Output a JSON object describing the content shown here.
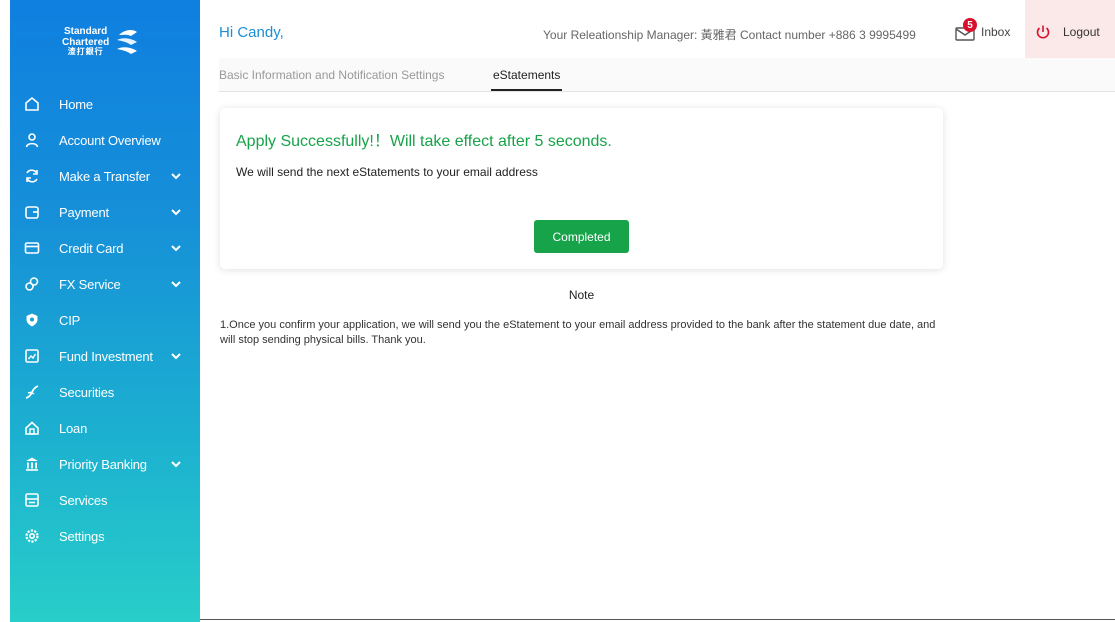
{
  "brand": {
    "line1": "Standard",
    "line2": "Chartered",
    "line3": "渣打銀行",
    "logo_colors": [
      "#0f4fa8",
      "#2fa84f"
    ]
  },
  "sidebar": {
    "items": [
      {
        "label": "Home",
        "icon": "home-icon",
        "expandable": false
      },
      {
        "label": "Account Overview",
        "icon": "user-icon",
        "expandable": false
      },
      {
        "label": "Make a Transfer",
        "icon": "transfer-icon",
        "expandable": true
      },
      {
        "label": "Payment",
        "icon": "wallet-icon",
        "expandable": true
      },
      {
        "label": "Credit Card",
        "icon": "credit-card-icon",
        "expandable": true
      },
      {
        "label": "FX Service",
        "icon": "fx-icon",
        "expandable": true
      },
      {
        "label": "CIP",
        "icon": "cip-icon",
        "expandable": false
      },
      {
        "label": "Fund Investment",
        "icon": "fund-icon",
        "expandable": true
      },
      {
        "label": "Securities",
        "icon": "securities-icon",
        "expandable": false
      },
      {
        "label": "Loan",
        "icon": "loan-icon",
        "expandable": false
      },
      {
        "label": "Priority Banking",
        "icon": "priority-banking-icon",
        "expandable": true
      },
      {
        "label": "Services",
        "icon": "services-icon",
        "expandable": false
      },
      {
        "label": "Settings",
        "icon": "settings-icon",
        "expandable": false
      }
    ]
  },
  "header": {
    "greeting": "Hi Candy,",
    "relationship_manager": "Your Releationship Manager: 黃雅君 Contact number +886 3 9995499",
    "inbox_label": "Inbox",
    "inbox_count": "5",
    "logout_label": "Logout"
  },
  "tabs": [
    {
      "label": "Basic Information and Notification Settings",
      "active": false
    },
    {
      "label": "eStatements",
      "active": true
    }
  ],
  "result": {
    "title": "Apply Successfully!！Will take effect after 5 seconds.",
    "message": "We will send the next eStatements to your email address",
    "button_label": "Completed"
  },
  "note": {
    "title": "Note",
    "text": "1.Once you confirm your application, we will send you the eStatement to your email address provided to the bank after the statement due date, and will stop sending physical bills. Thank you."
  },
  "colors": {
    "accent_blue": "#1a8fd6",
    "success_green": "#17a34a",
    "logout_bg": "#fbe9ea",
    "badge_red": "#d8102c"
  }
}
